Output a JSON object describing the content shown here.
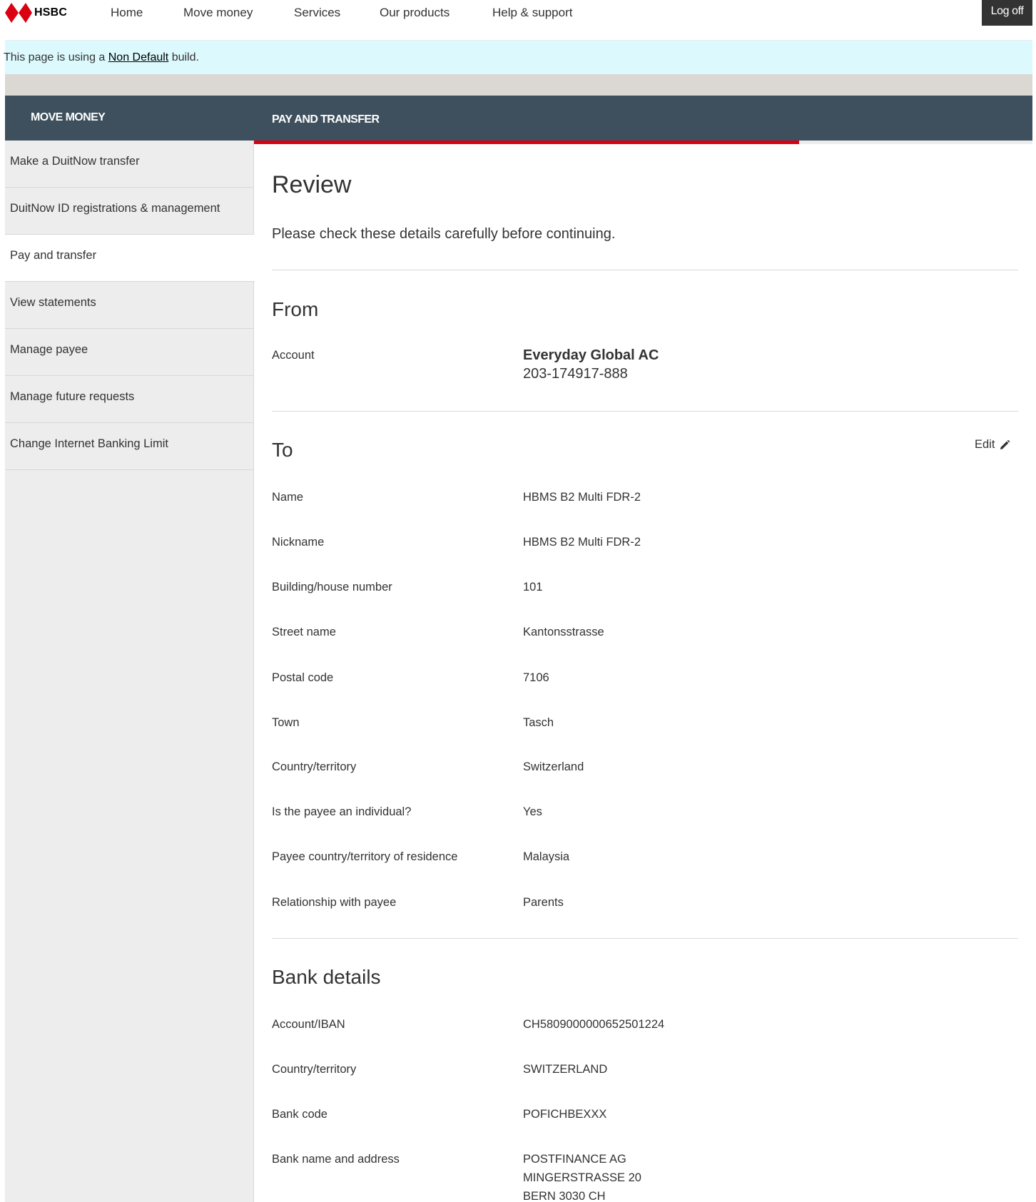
{
  "brand": {
    "name": "HSBC",
    "color": "#db0011"
  },
  "nav": {
    "items": [
      "Home",
      "Move money",
      "Services",
      "Our products",
      "Help & support"
    ],
    "logoff": "Log off"
  },
  "banner": {
    "prefix": "This page is using a ",
    "link": "Non Default",
    "suffix": " build."
  },
  "header": {
    "left": "MOVE MONEY",
    "right": "PAY AND TRANSFER"
  },
  "progress": {
    "fraction": 0.7
  },
  "sidebar": {
    "items": [
      {
        "label": "Make a DuitNow transfer",
        "active": false
      },
      {
        "label": "DuitNow ID registrations & management",
        "active": false
      },
      {
        "label": "Pay and transfer",
        "active": true
      },
      {
        "label": "View statements",
        "active": false
      },
      {
        "label": "Manage payee",
        "active": false
      },
      {
        "label": "Manage future requests",
        "active": false
      },
      {
        "label": "Change Internet Banking Limit",
        "active": false
      }
    ]
  },
  "review": {
    "title": "Review",
    "subtitle": "Please check these details carefully before continuing."
  },
  "from": {
    "title": "From",
    "account_label": "Account",
    "account_name": "Everyday Global AC",
    "account_number": "203-174917-888"
  },
  "to": {
    "title": "To",
    "edit_label": "Edit",
    "rows": [
      {
        "label": "Name",
        "value": "HBMS B2 Multi FDR-2"
      },
      {
        "label": "Nickname",
        "value": "HBMS B2 Multi FDR-2"
      },
      {
        "label": "Building/house number",
        "value": "101"
      },
      {
        "label": "Street name",
        "value": "Kantonsstrasse"
      },
      {
        "label": "Postal code",
        "value": "7106"
      },
      {
        "label": "Town",
        "value": "Tasch"
      },
      {
        "label": "Country/territory",
        "value": "Switzerland"
      },
      {
        "label": "Is the payee an individual?",
        "value": "Yes"
      },
      {
        "label": "Payee country/territory of residence",
        "value": "Malaysia"
      },
      {
        "label": "Relationship with payee",
        "value": "Parents"
      }
    ]
  },
  "bank": {
    "title": "Bank details",
    "rows": [
      {
        "label": "Account/IBAN",
        "value": "CH5809000000652501224"
      },
      {
        "label": "Country/territory",
        "value": "SWITZERLAND"
      },
      {
        "label": "Bank code",
        "value": "POFICHBEXXX"
      }
    ],
    "address_label": "Bank name and address",
    "address_lines": [
      "POSTFINANCE AG",
      "MINGERSTRASSE 20",
      "BERN 3030 CH"
    ]
  }
}
